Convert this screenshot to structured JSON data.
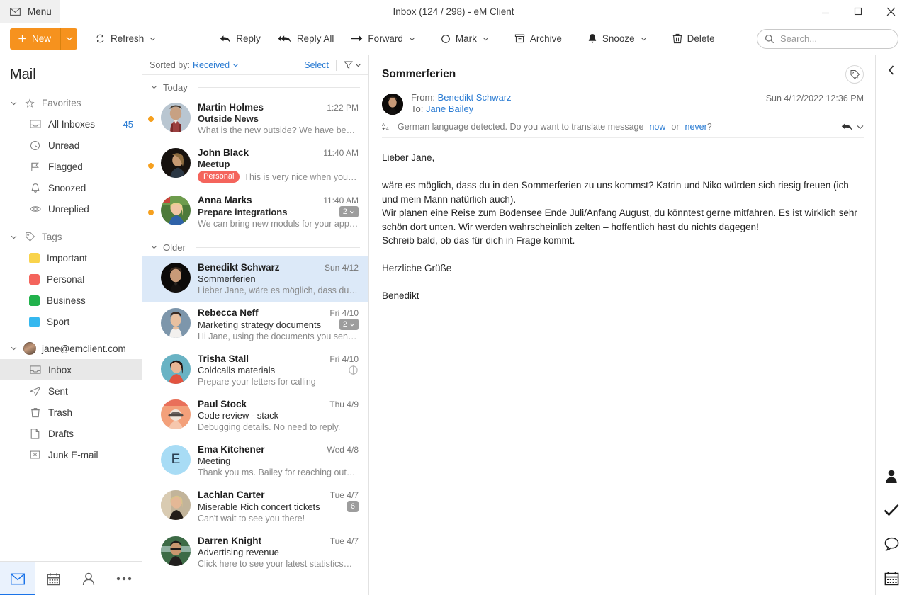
{
  "window": {
    "menu_label": "Menu",
    "title": "Inbox (124 / 298) - eM Client",
    "minimize": "–",
    "maximize": "□",
    "close": "×"
  },
  "toolbar": {
    "new_label": "New",
    "refresh_label": "Refresh",
    "reply_label": "Reply",
    "reply_all_label": "Reply All",
    "forward_label": "Forward",
    "mark_label": "Mark",
    "archive_label": "Archive",
    "snooze_label": "Snooze",
    "delete_label": "Delete",
    "search_placeholder": "Search...",
    "accent_color": "#f6921e"
  },
  "sidebar": {
    "title": "Mail",
    "favorites": {
      "label": "Favorites",
      "items": [
        {
          "label": "All Inboxes",
          "icon": "inbox-icon",
          "count": "45"
        },
        {
          "label": "Unread",
          "icon": "clock-icon",
          "count": ""
        },
        {
          "label": "Flagged",
          "icon": "flag-icon",
          "count": ""
        },
        {
          "label": "Snoozed",
          "icon": "bell-icon",
          "count": ""
        },
        {
          "label": "Unreplied",
          "icon": "eye-icon",
          "count": ""
        }
      ]
    },
    "tags": {
      "label": "Tags",
      "items": [
        {
          "label": "Important",
          "color": "#f9d34b"
        },
        {
          "label": "Personal",
          "color": "#f4645c"
        },
        {
          "label": "Business",
          "color": "#22b24c"
        },
        {
          "label": "Sport",
          "color": "#35b8ef"
        }
      ]
    },
    "account": {
      "label": "jane@emclient.com",
      "folders": [
        {
          "label": "Inbox",
          "icon": "inbox-icon",
          "selected": true
        },
        {
          "label": "Sent",
          "icon": "send-icon",
          "selected": false
        },
        {
          "label": "Trash",
          "icon": "trash-icon",
          "selected": false
        },
        {
          "label": "Drafts",
          "icon": "file-icon",
          "selected": false
        },
        {
          "label": "Junk E-mail",
          "icon": "junk-icon",
          "selected": false
        }
      ]
    },
    "bottom_nav": [
      {
        "name": "mail",
        "icon": "envelope-icon",
        "active": true
      },
      {
        "name": "calendar",
        "icon": "calendar-icon",
        "active": false
      },
      {
        "name": "contacts",
        "icon": "person-icon",
        "active": false
      },
      {
        "name": "more",
        "icon": "ellipsis-icon",
        "active": false
      }
    ]
  },
  "message_list": {
    "sorted_by_label": "Sorted by:",
    "sorted_by_value": "Received",
    "select_label": "Select",
    "groups": [
      {
        "label": "Today",
        "messages": [
          {
            "from": "Martin Holmes",
            "date": "1:22 PM",
            "subject": "Outside News",
            "preview": "What is the new outside? We have be…",
            "unread": true,
            "selected": false,
            "tag": "",
            "tag_color": "",
            "badge": "",
            "avatar_type": "photo",
            "avatar_colors": [
              "#b9c6d1",
              "#6d5a4c",
              "#9b3f3f"
            ],
            "initial": ""
          },
          {
            "from": "John Black",
            "date": "11:40 AM",
            "subject": "Meetup",
            "preview": "This is very nice when you…",
            "unread": true,
            "selected": false,
            "tag": "Personal",
            "tag_color": "#f4645c",
            "badge": "",
            "avatar_type": "photo",
            "avatar_colors": [
              "#1a1513",
              "#4e3a2c",
              "#b08b63"
            ],
            "initial": ""
          },
          {
            "from": "Anna Marks",
            "date": "11:40 AM",
            "subject": "Prepare integrations",
            "preview": "We can bring new moduls for your app…",
            "unread": true,
            "selected": false,
            "tag": "",
            "tag_color": "",
            "badge": "2",
            "avatar_type": "photo",
            "avatar_colors": [
              "#4d7a3a",
              "#e8d08c",
              "#2f62a8"
            ],
            "initial": ""
          }
        ]
      },
      {
        "label": "Older",
        "messages": [
          {
            "from": "Benedikt Schwarz",
            "date": "Sun 4/12",
            "subject": "Sommerferien",
            "preview": "Lieber Jane, wäre es möglich,  dass du…",
            "unread": false,
            "selected": true,
            "tag": "",
            "tag_color": "",
            "badge": "",
            "avatar_type": "photo",
            "avatar_colors": [
              "#0c0a09",
              "#6b4a38",
              "#caa185"
            ],
            "initial": ""
          },
          {
            "from": "Rebecca Neff",
            "date": "Fri 4/10",
            "subject": "Marketing strategy documents",
            "preview": "Hi Jane, using the documents you sent…",
            "unread": false,
            "selected": false,
            "tag": "",
            "tag_color": "",
            "badge": "2",
            "avatar_type": "photo",
            "avatar_colors": [
              "#6f8ca4",
              "#d9b79a",
              "#3a2a22"
            ],
            "initial": ""
          },
          {
            "from": "Trisha Stall",
            "date": "Fri 4/10",
            "subject": "Coldcalls materials",
            "preview": "Prepare your letters for calling",
            "unread": false,
            "selected": false,
            "tag": "",
            "tag_color": "",
            "badge": "",
            "marker": "target-icon",
            "avatar_type": "photo",
            "avatar_colors": [
              "#69b3c4",
              "#e8b79c",
              "#2a1a16"
            ],
            "initial": ""
          },
          {
            "from": "Paul Stock",
            "date": "Thu 4/9",
            "subject": "Code review - stack",
            "preview": "Debugging details. No need to reply.",
            "unread": false,
            "selected": false,
            "tag": "",
            "tag_color": "",
            "badge": "",
            "avatar_type": "photo",
            "avatar_colors": [
              "#f3a07a",
              "#efe4d8",
              "#55504c"
            ],
            "initial": ""
          },
          {
            "from": "Ema Kitchener",
            "date": "Wed 4/8",
            "subject": "Meeting",
            "preview": "Thank you ms. Bailey for reaching out…",
            "unread": false,
            "selected": false,
            "tag": "",
            "tag_color": "",
            "badge": "",
            "avatar_type": "initial",
            "avatar_colors": [
              "#a8dcf5"
            ],
            "initial": "E"
          },
          {
            "from": "Lachlan Carter",
            "date": "Tue 4/7",
            "subject": "Miserable Rich concert tickets",
            "preview": "Can't wait to see you there!",
            "unread": false,
            "selected": false,
            "tag": "",
            "tag_color": "",
            "badge": "6",
            "badge_plain": true,
            "avatar_type": "photo",
            "avatar_colors": [
              "#c9b99a",
              "#e3cba6",
              "#241d18"
            ],
            "initial": ""
          },
          {
            "from": "Darren Knight",
            "date": "Tue 4/7",
            "subject": "Advertising revenue",
            "preview": "Click here to see your latest statistics…",
            "unread": false,
            "selected": false,
            "tag": "",
            "tag_color": "",
            "badge": "",
            "avatar_type": "photo",
            "avatar_colors": [
              "#3d6b46",
              "#c8976f",
              "#1d1b1a"
            ],
            "initial": ""
          }
        ]
      }
    ]
  },
  "reader": {
    "subject": "Sommerferien",
    "from_label": "From:",
    "from_value": "Benedikt Schwarz",
    "to_label": "To:",
    "to_value": "Jane Bailey",
    "datetime": "Sun 4/12/2022 12:36 PM",
    "translate_text": "German language detected. Do you want to translate message",
    "translate_now": "now",
    "translate_or": "or",
    "translate_never": "never",
    "translate_q": "?",
    "body": "Lieber Jane,\n\nwäre es möglich, dass du in den Sommerferien zu uns kommst? Katrin und Niko würden sich riesig freuen (ich und mein Mann natürlich auch).\nWir planen eine Reise zum Bodensee Ende Juli/Anfang August, du könntest gerne mitfahren. Es ist wirklich sehr schön dort unten. Wir werden wahrscheinlich zelten – hoffentlich hast du nichts dagegen!\nSchreib bald, ob das für dich in Frage kommt.\n\nHerzliche Grüße\n\nBenedikt"
  },
  "right_rail": {
    "collapse_icon": "chevron-left-icon",
    "buttons": [
      {
        "name": "contacts-panel",
        "icon": "person-icon"
      },
      {
        "name": "tasks-panel",
        "icon": "check-icon"
      },
      {
        "name": "chat-panel",
        "icon": "chat-bubble-icon"
      },
      {
        "name": "calendar-panel",
        "icon": "calendar-icon"
      }
    ]
  }
}
